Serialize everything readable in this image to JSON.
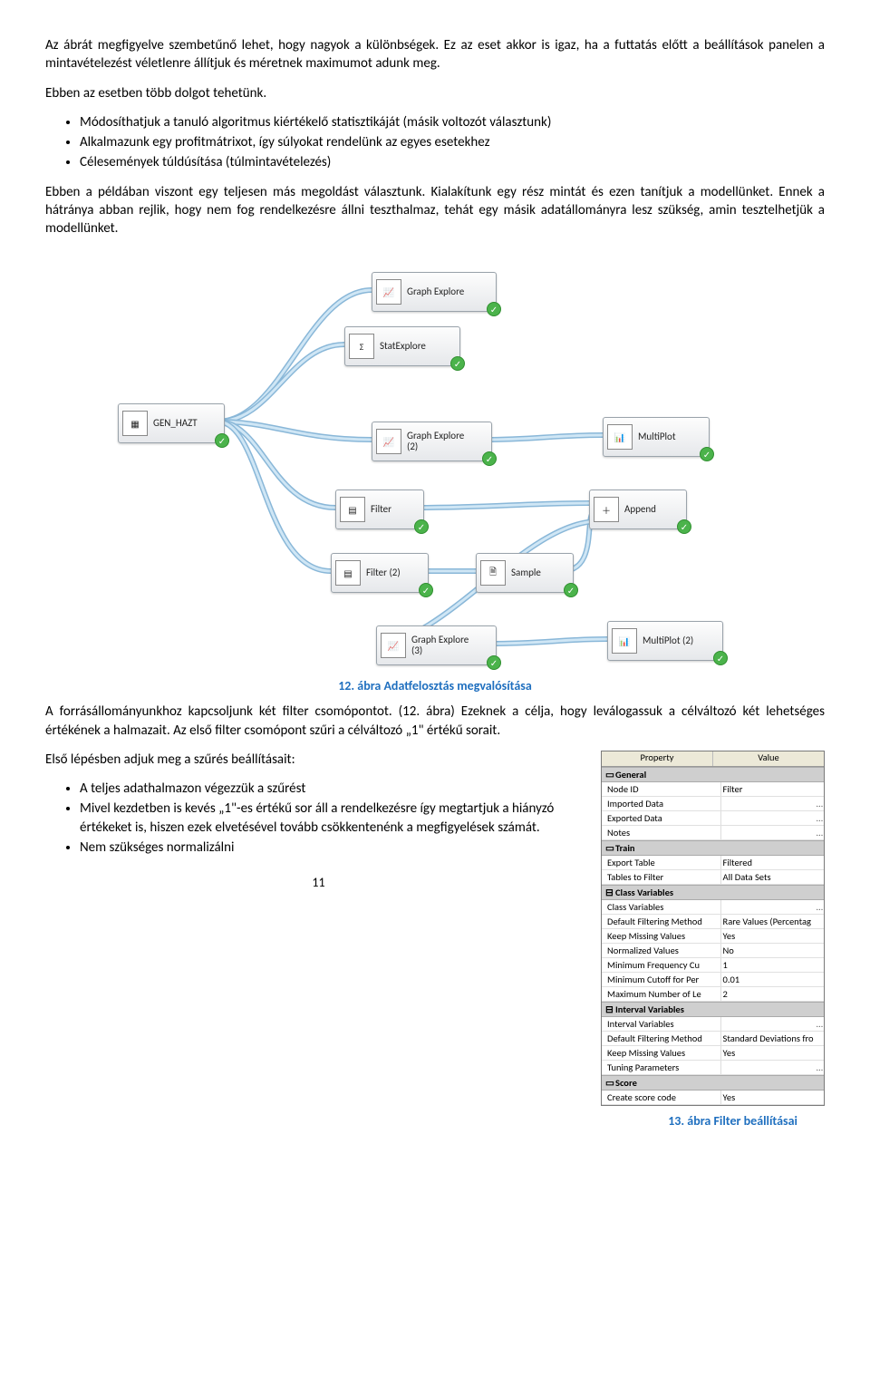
{
  "para1": "Az ábrát megfigyelve szembetűnő lehet, hogy nagyok a különbségek. Ez az eset akkor is igaz, ha a futtatás előtt a beállítások panelen a mintavételezést véletlenre állítjuk és méretnek maximumot adunk meg.",
  "para2": "Ebben az esetben több dolgot tehetünk.",
  "bullets1": {
    "b0": "Módosíthatjuk a tanuló algoritmus kiértékelő statisztikáját (másik voltozót választunk)",
    "b1": "Alkalmazunk egy profitmátrixot, így súlyokat rendelünk az egyes esetekhez",
    "b2": "Célesemények túldúsítása (túlmintavételezés)"
  },
  "para3": "Ebben a példában viszont egy teljesen más megoldást választunk. Kialakítunk egy rész mintát és ezen tanítjuk a modellünket. Ennek a hátránya abban rejlik, hogy nem fog rendelkezésre állni teszthalmaz, tehát egy másik adatállományra lesz szükség, amin tesztelhetjük a modellünket.",
  "diagram": {
    "gen_hazt": "GEN_HAZT",
    "graph_explore": "Graph Explore",
    "stat_explore": "StatExplore",
    "graph_explore2": "Graph Explore\n(2)",
    "multiplot": "MultiPlot",
    "filter": "Filter",
    "append": "Append",
    "filter2": "Filter (2)",
    "sample": "Sample",
    "graph_explore3": "Graph Explore\n(3)",
    "multiplot2": "MultiPlot (2)"
  },
  "caption1": "12. ábra Adatfelosztás megvalósítása",
  "para4": "A forrásállományunkhoz kapcsoljunk két filter csomópontot. (12. ábra) Ezeknek a célja, hogy leválogassuk a célváltozó két lehetséges értékének a halmazait. Az első filter csomópont szűri a célváltozó „1\" értékű sorait.",
  "para5": "Első lépésben adjuk meg a szűrés beállításait:",
  "bullets2": {
    "b0": "A teljes adathalmazon végezzük a szűrést",
    "b1": "Mivel kezdetben is kevés „1\"-es értékű sor áll a rendelkezésre így megtartjuk a hiányzó értékeket is, hiszen ezek elvetésével tovább csökkentenénk a megfigyelések számát.",
    "b2": "Nem szükséges normalizálni"
  },
  "panel": {
    "head_prop": "Property",
    "head_val": "Value",
    "general": "General",
    "node_id": "Node ID",
    "node_id_v": "Filter",
    "imported": "Imported Data",
    "exported": "Exported Data",
    "notes": "Notes",
    "train": "Train",
    "export_table": "Export Table",
    "export_table_v": "Filtered",
    "tables_to_filter": "Tables to Filter",
    "tables_to_filter_v": "All Data Sets",
    "class_vars_g": "Class Variables",
    "class_vars": "Class Variables",
    "def_filter_c": "Default Filtering Method",
    "def_filter_c_v": "Rare Values (Percentag",
    "keep_missing_c": "Keep Missing Values",
    "keep_missing_c_v": "Yes",
    "normalized": "Normalized Values",
    "normalized_v": "No",
    "min_freq": "Minimum Frequency Cu",
    "min_freq_v": "1",
    "min_cut": "Minimum Cutoff for Per",
    "min_cut_v": "0.01",
    "max_lev": "Maximum Number of Le",
    "max_lev_v": "2",
    "interval_g": "Interval Variables",
    "interval": "Interval Variables",
    "def_filter_i": "Default Filtering Method",
    "def_filter_i_v": "Standard Deviations fro",
    "keep_missing_i": "Keep Missing Values",
    "keep_missing_i_v": "Yes",
    "tuning": "Tuning Parameters",
    "score": "Score",
    "create_score": "Create score code",
    "create_score_v": "Yes"
  },
  "caption2": "13. ábra Filter beállításai",
  "page": "11"
}
